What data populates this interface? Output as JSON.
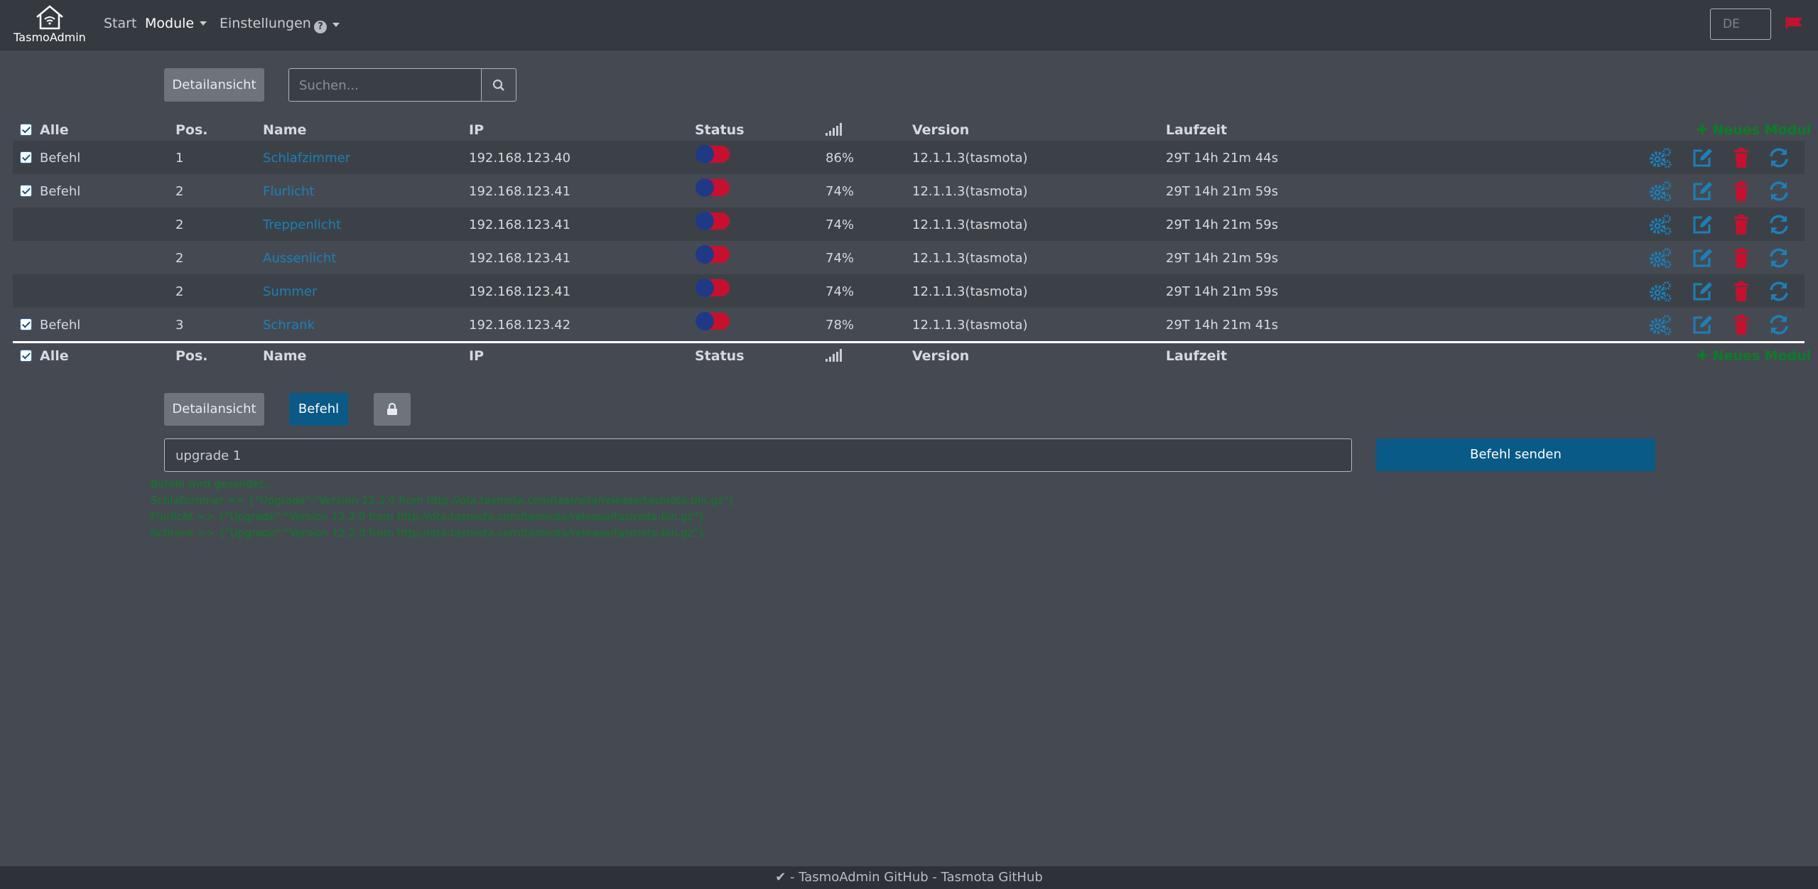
{
  "navbar": {
    "brand": "TasmoAdmin",
    "start": "Start",
    "module": "Module",
    "settings": "Einstellungen",
    "language": "DE"
  },
  "toolbar": {
    "detail_view": "Detailansicht",
    "search_placeholder": "Suchen..."
  },
  "table": {
    "headers": {
      "all": "Alle",
      "pos": "Pos.",
      "name": "Name",
      "ip": "IP",
      "status": "Status",
      "version": "Version",
      "uptime": "Laufzeit",
      "new_module": "Neues Modul"
    },
    "rows": [
      {
        "checked": true,
        "command": "Befehl",
        "pos": "1",
        "name": "Schlafzimmer",
        "ip": "192.168.123.40",
        "signal": "86%",
        "version": "12.1.1.3(tasmota)",
        "uptime": "29T 14h 21m 44s"
      },
      {
        "checked": true,
        "command": "Befehl",
        "pos": "2",
        "name": "Flurlicht",
        "ip": "192.168.123.41",
        "signal": "74%",
        "version": "12.1.1.3(tasmota)",
        "uptime": "29T 14h 21m 59s"
      },
      {
        "checked": false,
        "command": "",
        "pos": "2",
        "name": "Treppenlicht",
        "ip": "192.168.123.41",
        "signal": "74%",
        "version": "12.1.1.3(tasmota)",
        "uptime": "29T 14h 21m 59s"
      },
      {
        "checked": false,
        "command": "",
        "pos": "2",
        "name": "Aussenlicht",
        "ip": "192.168.123.41",
        "signal": "74%",
        "version": "12.1.1.3(tasmota)",
        "uptime": "29T 14h 21m 59s"
      },
      {
        "checked": false,
        "command": "",
        "pos": "2",
        "name": "Summer",
        "ip": "192.168.123.41",
        "signal": "74%",
        "version": "12.1.1.3(tasmota)",
        "uptime": "29T 14h 21m 59s"
      },
      {
        "checked": true,
        "command": "Befehl",
        "pos": "3",
        "name": "Schrank",
        "ip": "192.168.123.42",
        "signal": "78%",
        "version": "12.1.1.3(tasmota)",
        "uptime": "29T 14h 21m 41s"
      }
    ]
  },
  "command_bar": {
    "detail_view": "Detailansicht",
    "command": "Befehl",
    "input_value": "upgrade 1",
    "send": "Befehl senden"
  },
  "output_lines": [
    "Befehl wird gesendet...",
    "Schlafzimmer => {\"Upgrade\":\"Version 12.2.0 from http://ota.tasmota.com/tasmota/release/tasmota.bin.gz\"}",
    "Flurlicht => {\"Upgrade\":\"Version 12.2.0 from http://ota.tasmota.com/tasmota/release/tasmota.bin.gz\"}",
    "Schrank => {\"Upgrade\":\"Version 12.2.0 from http://ota.tasmota.com/tasmota/release/tasmota.bin.gz\"}"
  ],
  "footer": {
    "text": "- TasmoAdmin GitHub - Tasmota GitHub"
  },
  "colors": {
    "background": "#454a52",
    "link": "#1b80b8",
    "primary_button": "#095a86",
    "success": "#0a7d26",
    "danger": "#c8102e"
  },
  "icons": [
    "home-wifi-icon",
    "help-icon",
    "flag-icon",
    "search-icon",
    "signal-icon",
    "gears-icon",
    "edit-icon",
    "trash-icon",
    "sync-icon",
    "plus-icon",
    "lock-icon",
    "check-icon"
  ]
}
